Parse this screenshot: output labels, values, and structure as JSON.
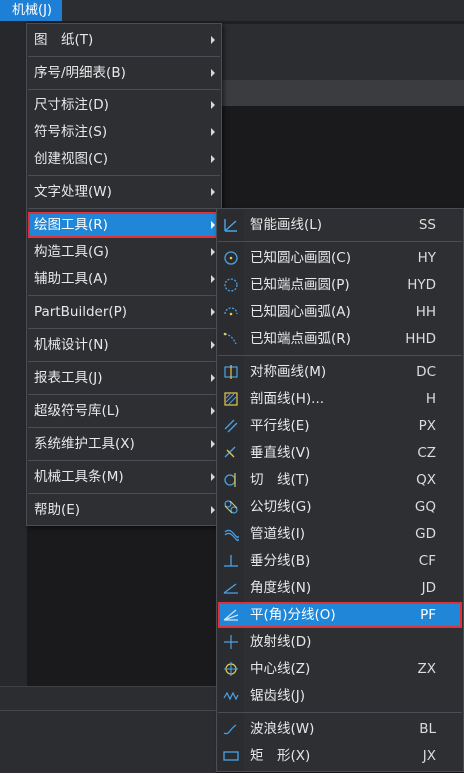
{
  "menubar": {
    "active_label": "机械(J)"
  },
  "main_menu": {
    "items": [
      {
        "label": "图　纸(T)"
      },
      {
        "label": "序号/明细表(B)"
      },
      {
        "label": "尺寸标注(D)"
      },
      {
        "label": "符号标注(S)"
      },
      {
        "label": "创建视图(C)"
      },
      {
        "label": "文字处理(W)"
      },
      {
        "label": "绘图工具(R)"
      },
      {
        "label": "构造工具(G)"
      },
      {
        "label": "辅助工具(A)"
      },
      {
        "label": "PartBuilder(P)"
      },
      {
        "label": "机械设计(N)"
      },
      {
        "label": "报表工具(J)"
      },
      {
        "label": "超级符号库(L)"
      },
      {
        "label": "系统维护工具(X)"
      },
      {
        "label": "机械工具条(M)"
      },
      {
        "label": "帮助(E)"
      }
    ]
  },
  "sub_menu": {
    "items": [
      {
        "label": "智能画线(L)",
        "shortcut": "SS",
        "icon": "smart-line-icon"
      },
      {
        "label": "已知圆心画圆(C)",
        "shortcut": "HY",
        "icon": "circle-center-icon"
      },
      {
        "label": "已知端点画圆(P)",
        "shortcut": "HYD",
        "icon": "circle-endpoint-icon"
      },
      {
        "label": "已知圆心画弧(A)",
        "shortcut": "HH",
        "icon": "arc-center-icon"
      },
      {
        "label": "已知端点画弧(R)",
        "shortcut": "HHD",
        "icon": "arc-endpoint-icon"
      },
      {
        "label": "对称画线(M)",
        "shortcut": "DC",
        "icon": "symmetric-line-icon"
      },
      {
        "label": "剖面线(H)...",
        "shortcut": "H",
        "icon": "hatch-icon"
      },
      {
        "label": "平行线(E)",
        "shortcut": "PX",
        "icon": "parallel-line-icon"
      },
      {
        "label": "垂直线(V)",
        "shortcut": "CZ",
        "icon": "perpendicular-line-icon"
      },
      {
        "label": "切　线(T)",
        "shortcut": "QX",
        "icon": "tangent-line-icon"
      },
      {
        "label": "公切线(G)",
        "shortcut": "GQ",
        "icon": "common-tangent-icon"
      },
      {
        "label": "管道线(I)",
        "shortcut": "GD",
        "icon": "pipe-line-icon"
      },
      {
        "label": "垂分线(B)",
        "shortcut": "CF",
        "icon": "perpendicular-bisector-icon"
      },
      {
        "label": "角度线(N)",
        "shortcut": "JD",
        "icon": "angle-line-icon"
      },
      {
        "label": "平(角)分线(O)",
        "shortcut": "PF",
        "icon": "angle-bisector-icon"
      },
      {
        "label": "放射线(D)",
        "shortcut": "",
        "icon": "ray-line-icon"
      },
      {
        "label": "中心线(Z)",
        "shortcut": "ZX",
        "icon": "center-line-icon"
      },
      {
        "label": "锯齿线(J)",
        "shortcut": "",
        "icon": "zigzag-line-icon"
      },
      {
        "label": "波浪线(W)",
        "shortcut": "BL",
        "icon": "wave-line-icon"
      },
      {
        "label": "矩　形(X)",
        "shortcut": "JX",
        "icon": "rectangle-icon"
      }
    ]
  },
  "colors": {
    "highlight": "#1f86d8",
    "highlight_border": "#e0313b",
    "menu_bg": "#2d2f33",
    "icon": "#4aa3e8"
  }
}
